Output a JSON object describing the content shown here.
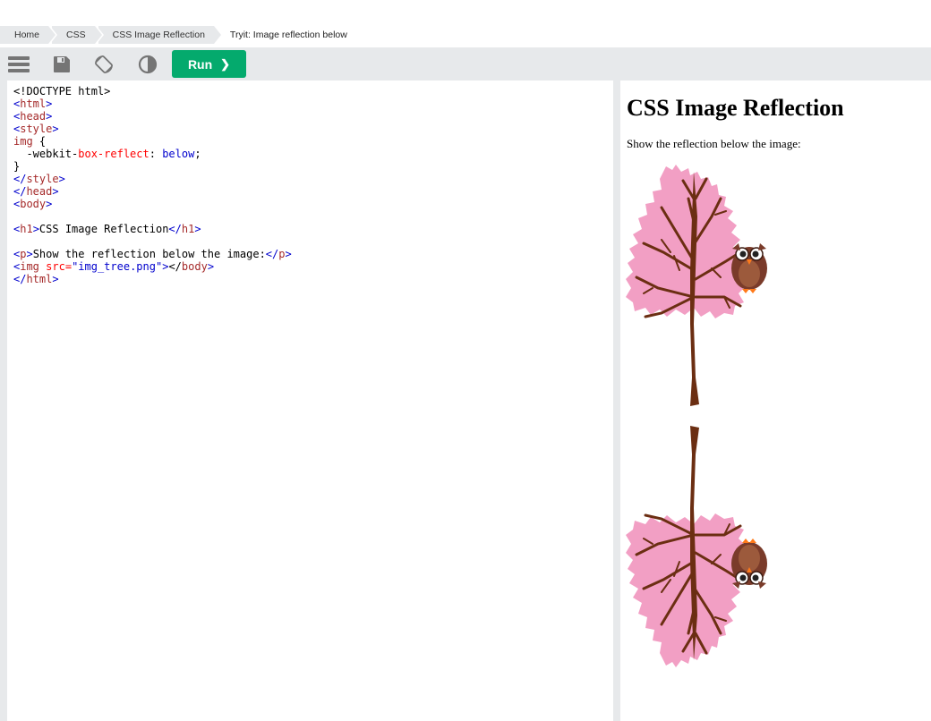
{
  "breadcrumb": [
    "Home",
    "CSS",
    "CSS Image Reflection",
    "Tryit: Image reflection below"
  ],
  "toolbar": {
    "icons": [
      "menu-icon",
      "save-icon",
      "rotate-icon",
      "contrast-icon"
    ],
    "run_label": "Run",
    "run_color": "#04aa6d"
  },
  "code_lines": [
    "<!DOCTYPE html>",
    "<html>",
    "<head>",
    "<style>",
    "img {",
    "  -webkit-box-reflect: below;",
    "}",
    "</style>",
    "</head>",
    "<body>",
    "",
    "<h1>CSS Image Reflection</h1>",
    "",
    "<p>Show the reflection below the image:</p>",
    "<img src=\"img_tree.png\">",
    "",
    "",
    "",
    "</body>",
    "</html>"
  ],
  "result": {
    "heading": "CSS Image Reflection",
    "paragraph": "Show the reflection below the image:",
    "image_colors": {
      "foliage": "#f29fc4",
      "trunk": "#6b2e12",
      "owl": "#7a3b2a",
      "beak": "#ff7a1a"
    }
  }
}
